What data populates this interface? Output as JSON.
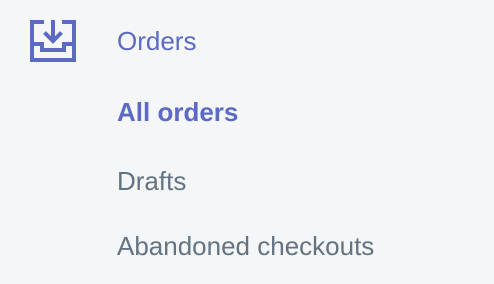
{
  "nav": {
    "section": {
      "label": "Orders",
      "icon": "orders-inbox-icon"
    },
    "items": [
      {
        "label": "All orders",
        "active": true
      },
      {
        "label": "Drafts",
        "active": false
      },
      {
        "label": "Abandoned checkouts",
        "active": false
      }
    ]
  },
  "colors": {
    "background": "#f4f6f8",
    "accent": "#5c6ac4",
    "subdued": "#637381"
  }
}
